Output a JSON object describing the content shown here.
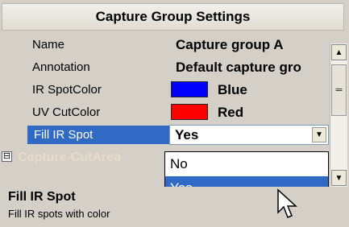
{
  "header": {
    "title": "Capture Group Settings"
  },
  "properties": [
    {
      "name": "Name",
      "value": "Capture group A"
    },
    {
      "name": "Annotation",
      "value": "Default capture gro"
    },
    {
      "name": "IR SpotColor",
      "value": "Blue",
      "color": "#0000ff"
    },
    {
      "name": "UV CutColor",
      "value": "Red",
      "color": "#ff0000"
    },
    {
      "name": "Fill IR Spot",
      "value": "Yes"
    }
  ],
  "category": {
    "label": "Capture-CutArea",
    "expander": "⊟"
  },
  "dropdown": {
    "options": [
      "No",
      "Yes"
    ],
    "selected": "Yes"
  },
  "description": {
    "title": "Fill IR Spot",
    "text": "Fill IR spots with color"
  },
  "icons": {
    "scroll_up": "▲",
    "scroll_down": "▼",
    "dropdown_arrow": "▼",
    "thumb_grip": "═"
  },
  "colors": {
    "selection": "#316ac5"
  }
}
